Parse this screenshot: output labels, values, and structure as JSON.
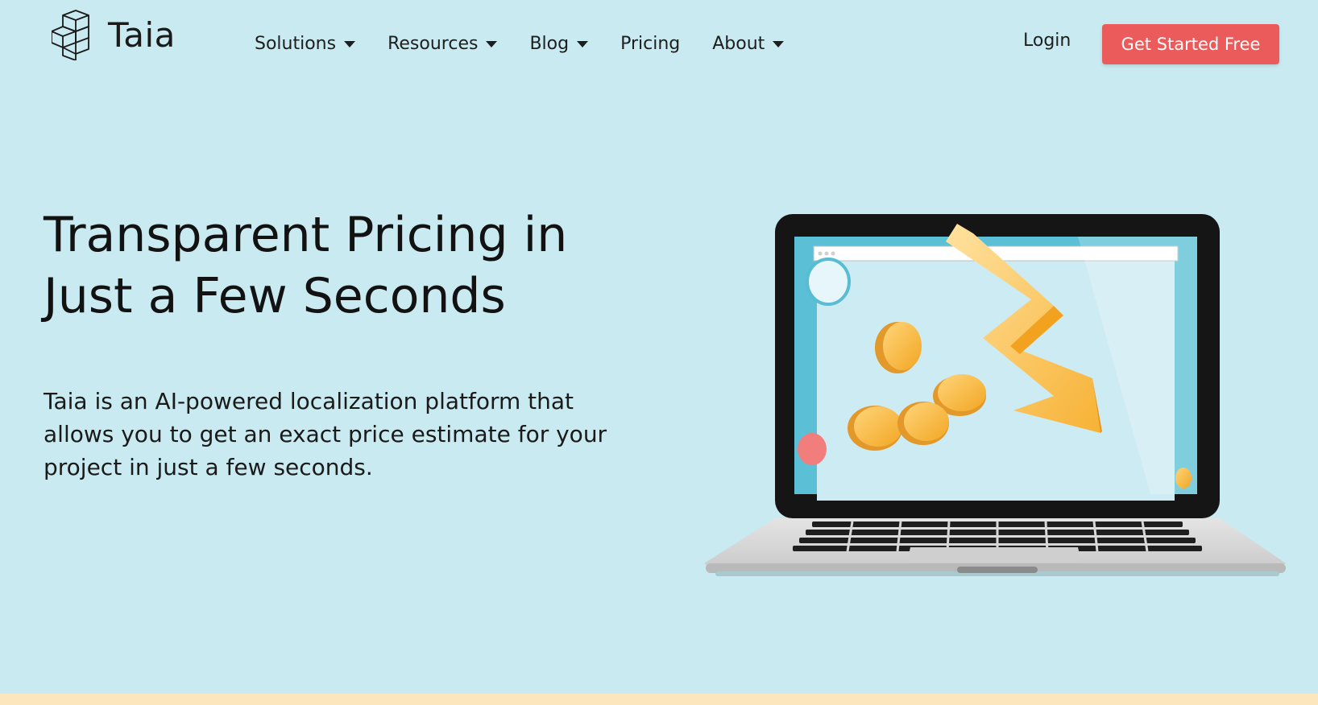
{
  "brand": {
    "name": "Taia",
    "logo_icon": "cube-stack-icon"
  },
  "nav": {
    "items": [
      {
        "label": "Solutions",
        "has_dropdown": true
      },
      {
        "label": "Resources",
        "has_dropdown": true
      },
      {
        "label": "Blog",
        "has_dropdown": true
      },
      {
        "label": "Pricing",
        "has_dropdown": false
      },
      {
        "label": "About",
        "has_dropdown": true
      }
    ],
    "login_label": "Login",
    "cta_label": "Get Started Free"
  },
  "hero": {
    "title_line1": "Transparent Pricing in",
    "title_line2": "Just a Few Seconds",
    "description_line1": "Taia is an AI-powered localization platform that",
    "description_line2": "allows you to get an exact price estimate for your",
    "description_line3": "project in just a few seconds."
  },
  "colors": {
    "background": "#c8eaf0",
    "cta": "#ec5b5b",
    "footer_strip": "#fbe6bd",
    "coin": "#f6b73c",
    "screen": "#5bc0d5"
  }
}
